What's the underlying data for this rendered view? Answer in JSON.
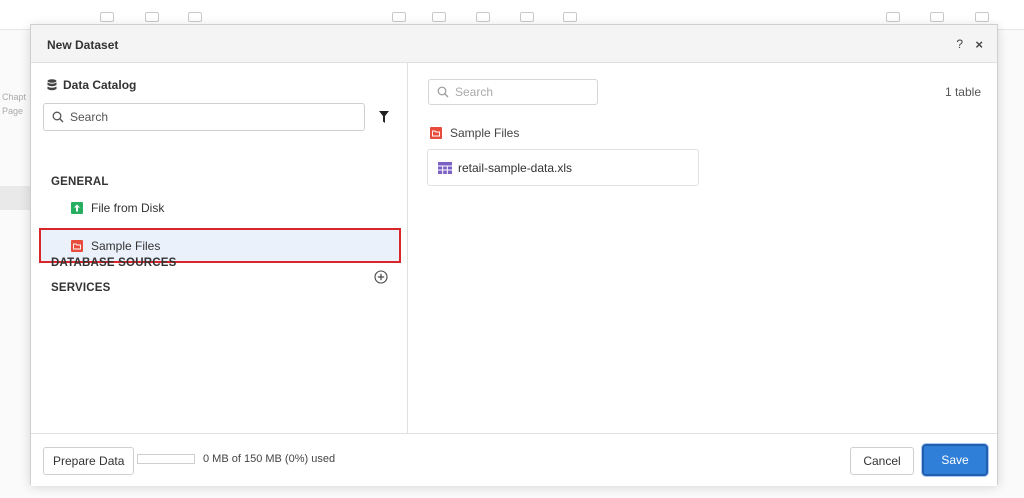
{
  "background": {
    "side_labels": [
      "Chapt",
      "Page"
    ]
  },
  "dialog": {
    "title": "New Dataset",
    "help_label": "?",
    "close_label": "×"
  },
  "catalog": {
    "title": "Data Catalog",
    "search_placeholder": "Search",
    "sections": {
      "general": "GENERAL",
      "database_sources": "DATABASE SOURCES",
      "services": "SERVICES"
    },
    "items": [
      {
        "label": "File from Disk",
        "icon": "upload-file-icon",
        "color": "#27ae60"
      },
      {
        "label": "Sample Files",
        "icon": "folder-icon",
        "color": "#e74c3c"
      }
    ]
  },
  "content": {
    "search_placeholder": "Search",
    "table_count": "1 table",
    "folder_label": "Sample Files",
    "files": [
      {
        "name": "retail-sample-data.xls",
        "icon": "table-icon",
        "color": "#7b61c4"
      }
    ]
  },
  "footer": {
    "prepare_label": "Prepare Data",
    "usage_text": "0 MB of 150 MB (0%) used",
    "usage_percent": 0,
    "cancel_label": "Cancel",
    "save_label": "Save"
  },
  "colors": {
    "accent": "#2f7fd8",
    "highlight_border": "#d9262b",
    "selection_bg": "#eaf1fb"
  }
}
